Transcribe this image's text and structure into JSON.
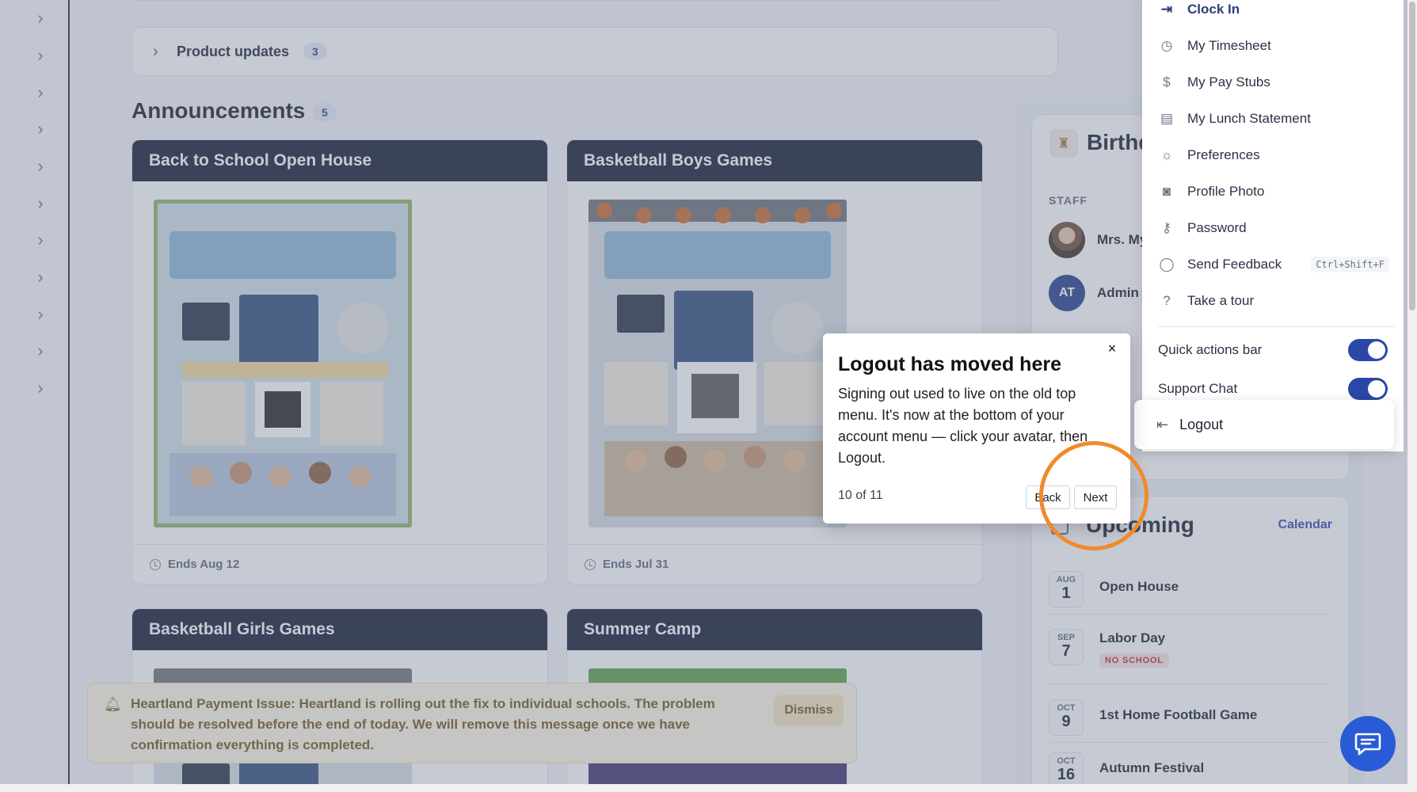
{
  "main": {
    "product_updates": {
      "label": "Product updates",
      "count": "3"
    },
    "announcements": {
      "title": "Announcements",
      "count": "5",
      "cards": [
        {
          "title": "Back to School Open House",
          "footer": "Ends Aug 12"
        },
        {
          "title": "Basketball Boys Games",
          "footer": "Ends Jul 31"
        },
        {
          "title": "Basketball Girls Games"
        },
        {
          "title": "Summer Camp"
        }
      ]
    }
  },
  "notice": {
    "text": "Heartland Payment Issue: Heartland is rolling out the fix to individual schools. The problem should be resolved before the end of today. We will remove this message once we have confirmation everything is completed.",
    "dismiss_label": "Dismiss"
  },
  "birthdays": {
    "title": "Birthd",
    "section_label": "STAFF",
    "people": [
      {
        "name": "Mrs. My"
      },
      {
        "initials": "AT",
        "name": "Admin"
      }
    ]
  },
  "upcoming": {
    "title": "Upcoming",
    "calendar_link": "Calendar",
    "events": [
      {
        "month": "AUG",
        "day": "1",
        "name": "Open House"
      },
      {
        "month": "SEP",
        "day": "7",
        "name": "Labor Day",
        "tag": "NO SCHOOL"
      },
      {
        "month": "OCT",
        "day": "9",
        "name": "1st Home Football Game"
      },
      {
        "month": "OCT",
        "day": "16",
        "name": "Autumn Festival"
      }
    ]
  },
  "account_menu": {
    "clock_in": "Clock In",
    "items": [
      "My Timesheet",
      "My Pay Stubs",
      "My Lunch Statement",
      "Preferences",
      "Profile Photo",
      "Password",
      "Send Feedback",
      "Take a tour"
    ],
    "feedback_shortcut": "Ctrl+Shift+F",
    "toggles": [
      {
        "label": "Quick actions bar",
        "on": true
      },
      {
        "label": "Support Chat",
        "on": true
      }
    ],
    "logout_label": "Logout"
  },
  "tour": {
    "title": "Logout has moved here",
    "body": "Signing out used to live on the old top menu. It's now at the bottom of your account menu — click your avatar, then Logout.",
    "progress": "10 of 11",
    "back_label": "Back",
    "next_label": "Next",
    "close_label": "×"
  },
  "colors": {
    "primary": "#2a47a8",
    "card_header": "#0e1830",
    "highlight_ring": "#f08a2c",
    "notice_bg": "#fdf6e3",
    "chat_fab": "#2a5bd7"
  },
  "icons": {
    "rail": "chevron-right-icon",
    "clock_in": "sign-in-icon",
    "logout": "sign-out-icon",
    "chat": "chat-bubble-icon"
  }
}
